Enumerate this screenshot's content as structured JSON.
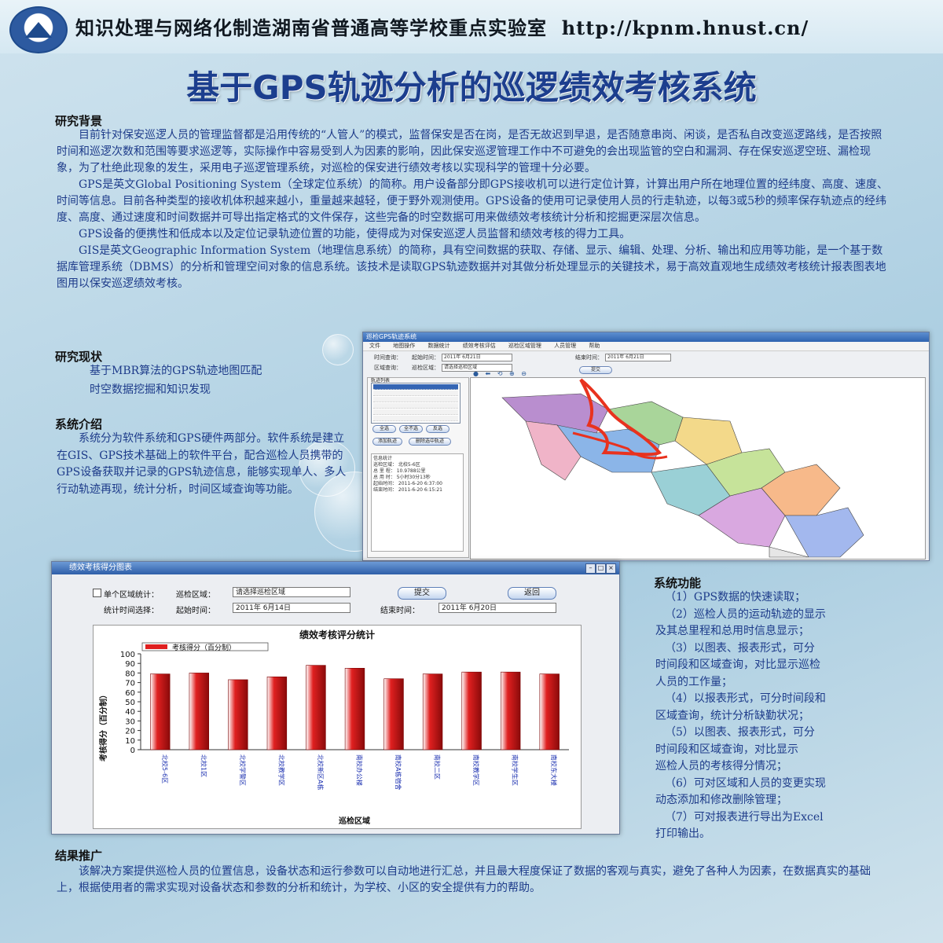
{
  "header": {
    "lab_name": "知识处理与网络化制造湖南省普通高等学校重点实验室",
    "url": "http://kpnm.hnust.cn/"
  },
  "title": "基于GPS轨迹分析的巡逻绩效考核系统",
  "background": {
    "heading": "研究背景",
    "paragraphs": [
      "目前针对保安巡逻人员的管理监督都是沿用传统的“人管人”的模式，监督保安是否在岗，是否无故迟到早退，是否随意串岗、闲谈，是否私自改变巡逻路线，是否按照时间和巡逻次数和范围等要求巡逻等，实际操作中容易受到人为因素的影响，因此保安巡逻管理工作中不可避免的会出现监管的空白和漏洞、存在保安巡逻空班、漏检现象，为了杜绝此现象的发生，采用电子巡逻管理系统，对巡检的保安进行绩效考核以实现科学的管理十分必要。",
      "GPS是英文Global Positioning System（全球定位系统）的简称。用户设备部分即GPS接收机可以进行定位计算，计算出用户所在地理位置的经纬度、高度、速度、时间等信息。目前各种类型的接收机体积越来越小，重量越来越轻，便于野外观测使用。GPS设备的使用可记录使用人员的行走轨迹，以每3或5秒的频率保存轨迹点的经纬度、高度、通过速度和时间数据并可导出指定格式的文件保存，这些完备的时空数据可用来做绩效考核统计分析和挖掘更深层次信息。",
      "GPS设备的便携性和低成本以及定位记录轨迹位置的功能，使得成为对保安巡逻人员监督和绩效考核的得力工具。",
      "GIS是英文Geographic Information System（地理信息系统）的简称，具有空间数据的获取、存储、显示、编辑、处理、分析、输出和应用等功能，是一个基于数据库管理系统（DBMS）的分析和管理空间对象的信息系统。该技术是读取GPS轨迹数据并对其做分析处理显示的关键技术，易于高效直观地生成绩效考核统计报表图表地图用以保安巡逻绩效考核。"
    ]
  },
  "status": {
    "heading": "研究现状",
    "items": [
      "基于MBR算法的GPS轨迹地图匹配",
      "时空数据挖掘和知识发现"
    ]
  },
  "intro": {
    "heading": "系统介绍",
    "text": "系统分为软件系统和GPS硬件两部分。软件系统是建立在GIS、GPS技术基础上的软件平台，配合巡检人员携带的GPS设备获取并记录的GPS轨迹信息，能够实现单人、多人行动轨迹再现，统计分析，时间区域查询等功能。"
  },
  "functions": {
    "heading": "系统功能",
    "lines": [
      "（1）GPS数据的快速读取；",
      "（2）巡检人员的运动轨迹的显示",
      "及其总里程和总用时信息显示；",
      "（3）以图表、报表形式，可分",
      "时间段和区域查询，对比显示巡检",
      "人员的工作量；",
      "（4）以报表形式，可分时间段和",
      "区域查询，统计分析缺勤状况；",
      "（5）以图表、报表形式，可分",
      "时间段和区域查询，对比显示",
      "巡检人员的考核得分情况；",
      "（6）可对区域和人员的变更实现",
      "动态添加和修改删除管理；",
      "（7）可对报表进行导出为Excel",
      "打印输出。"
    ]
  },
  "result": {
    "heading": "结果推广",
    "text": "该解决方案提供巡检人员的位置信息，设备状态和运行参数可以自动地进行汇总，并且最大程度保证了数据的客观与真实，避免了各种人为因素，在数据真实的基础上，根据使用者的需求实现对设备状态和参数的分析和统计，为学校、小区的安全提供有力的帮助。"
  },
  "gps_app": {
    "window_title": "巡检GPS轨迹系统",
    "menu": [
      "文件",
      "地图操作",
      "数据统计",
      "绩效考核评估",
      "巡检区域管理",
      "人员管理",
      "帮助"
    ],
    "period_label": "时间查询：",
    "start_label": "起始时间：",
    "start_value": "2011年 6月21日",
    "end_label": "结束时间：",
    "end_value": "2011年 6月21日",
    "region_label": "区域查询：",
    "patrol_label": "巡检区域：",
    "region_value": "请选择巡检区域",
    "submit": "提交",
    "list_title": "轨迹列表",
    "buttons": [
      "全选",
      "全不选",
      "反选",
      "添加轨迹",
      "删除选中轨迹"
    ],
    "info_title": "信息统计",
    "info": [
      "巡检区域：    北校5-6区",
      "总 里 程：    10.9788公里",
      "总 用 时：    5小时30分13秒",
      "起始时间：    2011-6-20 6:37:00",
      "结束时间：    2011-6-20 6:15:21"
    ]
  },
  "chart_window": {
    "title": "绩效考核得分图表",
    "single_region_label": "单个区域统计：",
    "patrol_region_label": "巡检区域：",
    "region_placeholder": "请选择巡检区域",
    "submit": "提交",
    "back": "返回",
    "period_label": "统计时间选择：",
    "start_label": "起始时间：",
    "start_value": "2011年 6月14日",
    "end_label": "结束时间：",
    "end_value": "2011年 6月20日"
  },
  "chart_data": {
    "type": "bar",
    "title": "绩效考核评分统计",
    "xlabel": "巡检区域",
    "ylabel": "考核得分（百分制）",
    "ylim": [
      0,
      100
    ],
    "yticks": [
      0,
      10,
      20,
      30,
      40,
      50,
      60,
      70,
      80,
      90,
      100
    ],
    "categories": [
      "北校5-6区",
      "北校1区",
      "北校学警区",
      "北校教学区",
      "北校新区A栋",
      "南校办公楼",
      "南校A栋宿舍",
      "南校二区",
      "南校教学区",
      "南校学生区",
      "南校东大楼"
    ],
    "series": [
      {
        "name": "考核得分（百分制）",
        "values": [
          79,
          80,
          73,
          76,
          88,
          85,
          74,
          79,
          81,
          81,
          79
        ]
      }
    ],
    "bar_color": "#e02020",
    "legend": "top-left",
    "grid": false
  }
}
